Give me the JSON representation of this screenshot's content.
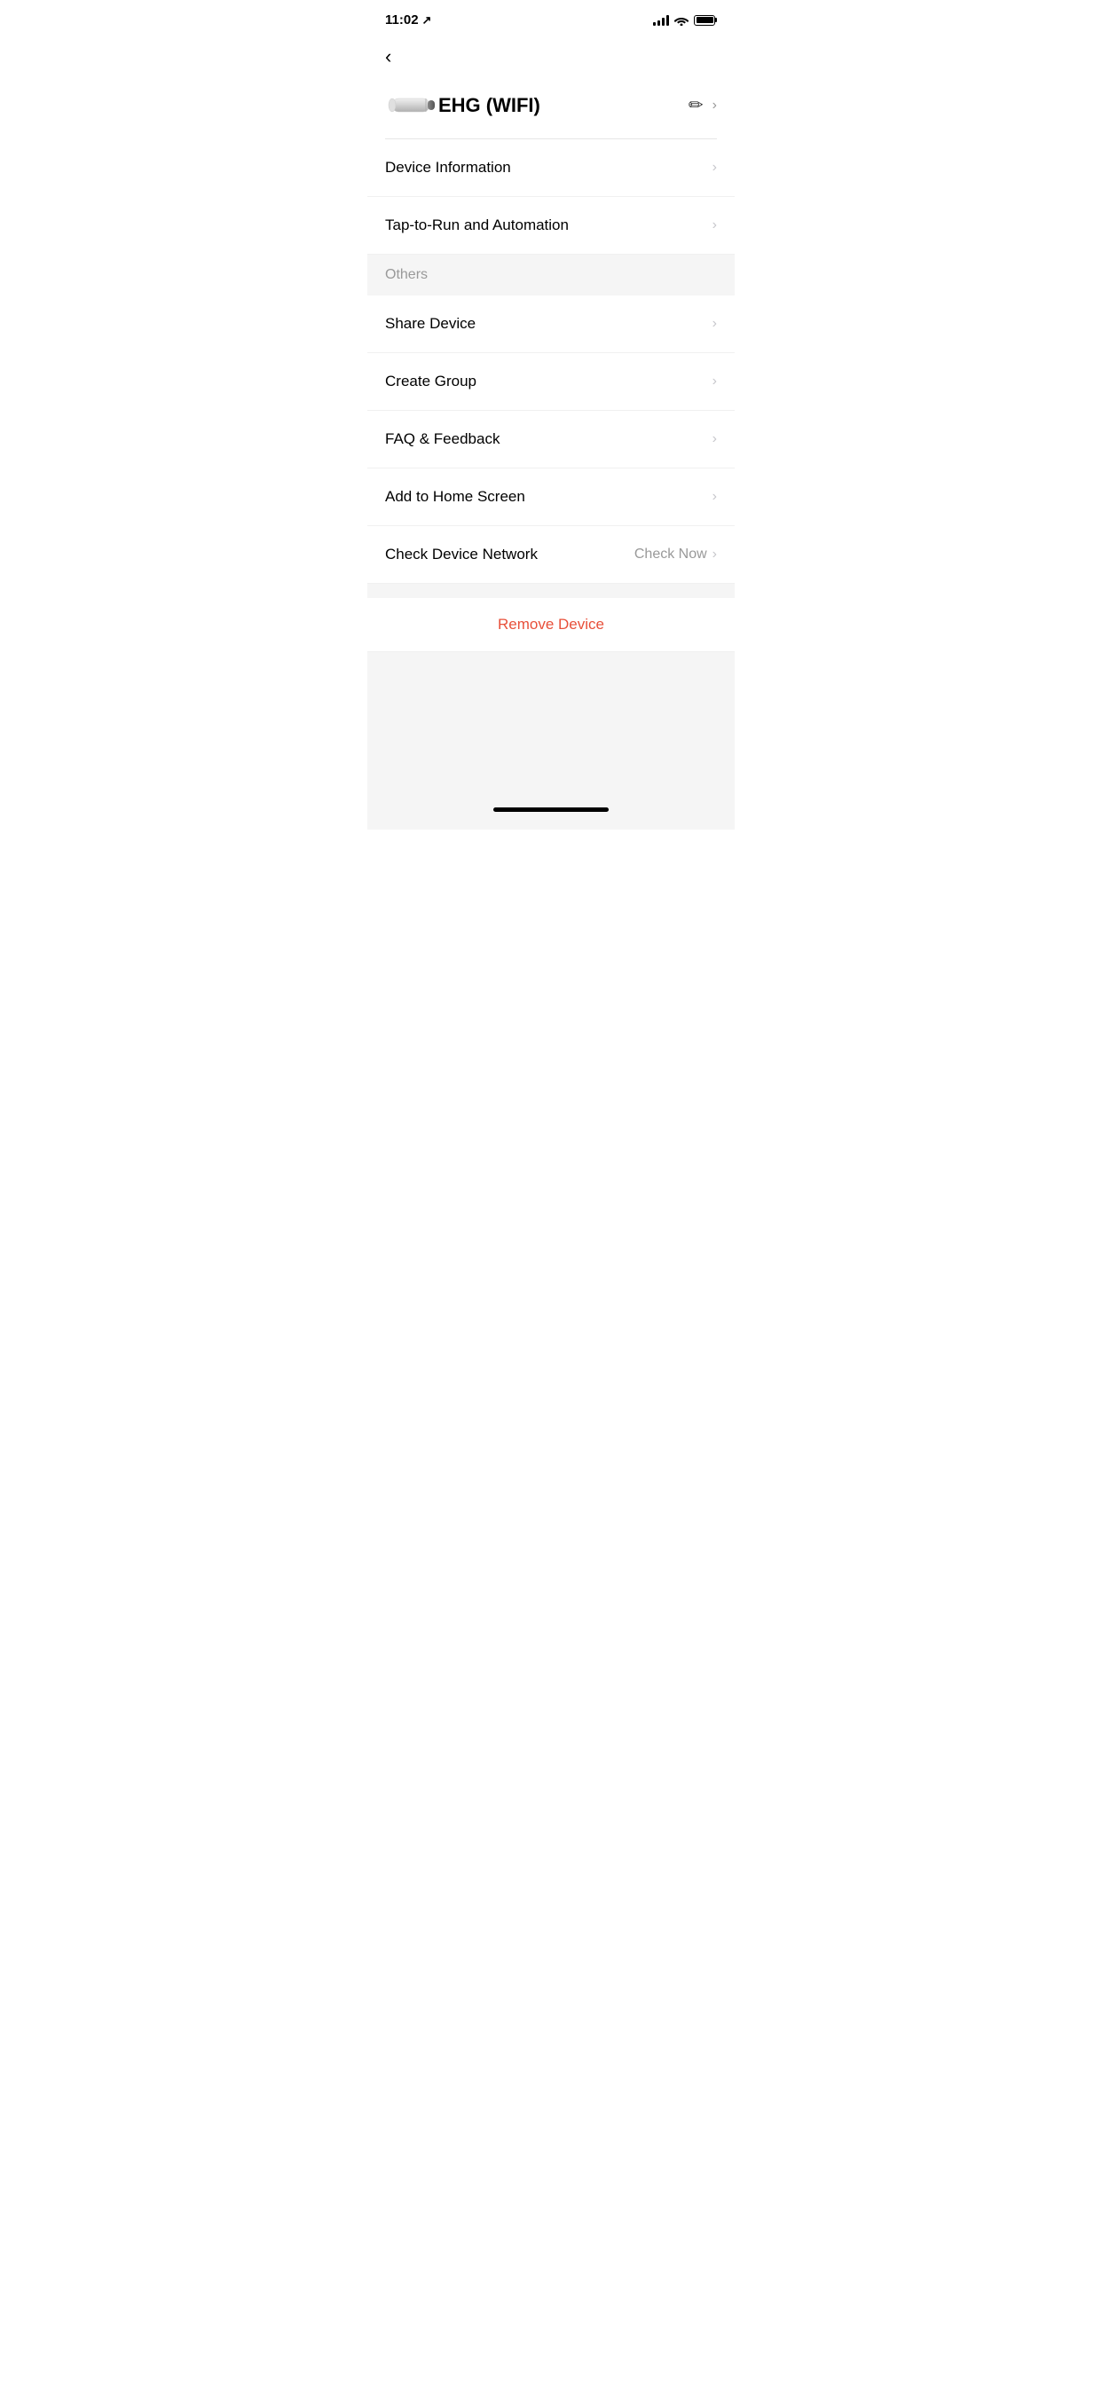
{
  "statusBar": {
    "time": "11:02",
    "locationIcon": "↗"
  },
  "header": {
    "backLabel": "<",
    "deviceTitle": "EHG (WIFI)",
    "editIconLabel": "✏",
    "chevronLabel": "›"
  },
  "menuSections": [
    {
      "items": [
        {
          "label": "Device Information",
          "value": "",
          "chevron": "›"
        },
        {
          "label": "Tap-to-Run and Automation",
          "value": "",
          "chevron": "›"
        }
      ]
    }
  ],
  "othersSection": {
    "label": "Others",
    "items": [
      {
        "label": "Share Device",
        "value": "",
        "chevron": "›"
      },
      {
        "label": "Create Group",
        "value": "",
        "chevron": "›"
      },
      {
        "label": "FAQ & Feedback",
        "value": "",
        "chevron": "›"
      },
      {
        "label": "Add to Home Screen",
        "value": "",
        "chevron": "›"
      },
      {
        "label": "Check Device Network",
        "value": "Check Now",
        "chevron": "›"
      }
    ]
  },
  "removeDevice": {
    "label": "Remove Device"
  }
}
